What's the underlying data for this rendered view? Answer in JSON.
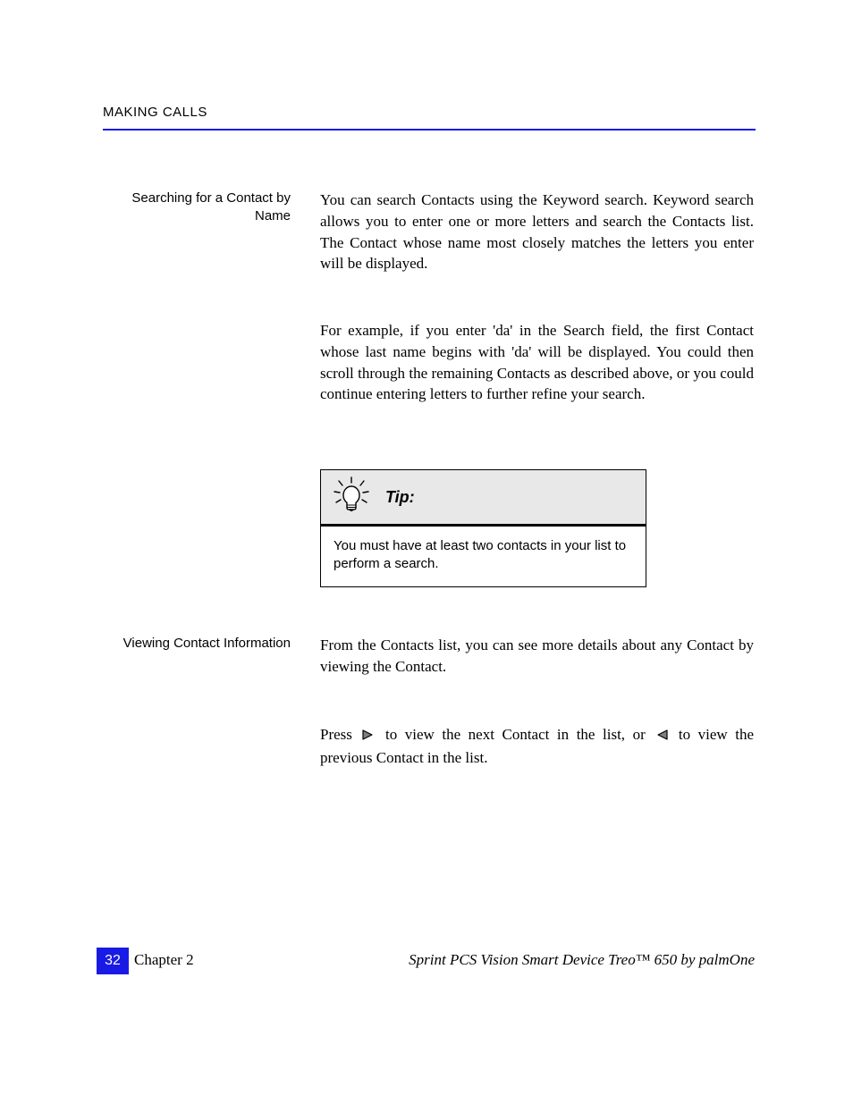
{
  "header": "MAKING CALLS",
  "sidebar": {
    "one": "Searching for a Contact by Name",
    "two": "Viewing Contact Information"
  },
  "body": {
    "p1": "You can search Contacts using the Keyword search. Keyword search allows you to enter one or more letters and search the Contacts list. The Contact whose name most closely matches the letters you enter will be displayed.",
    "p2": "For example, if you enter 'da' in the Search field, the first Contact whose last name begins with 'da' will be displayed. You could then scroll through the remaining Contacts as described above, or you could continue entering letters to further refine your search.",
    "p3": "From the Contacts list, you can see more details about any Contact by viewing the Contact.",
    "p4_prefix": "Press ",
    "p4_mid": " to view the next Contact in the list, or ",
    "p4_suffix": " to view the previous Contact in the list."
  },
  "tip": {
    "title": "Tip:",
    "text": "You must have at least two contacts in your list to perform a search."
  },
  "footer": {
    "page": "32",
    "left": "Chapter 2",
    "right": "Sprint PCS Vision Smart Device Treo™ 650 by palmOne"
  }
}
